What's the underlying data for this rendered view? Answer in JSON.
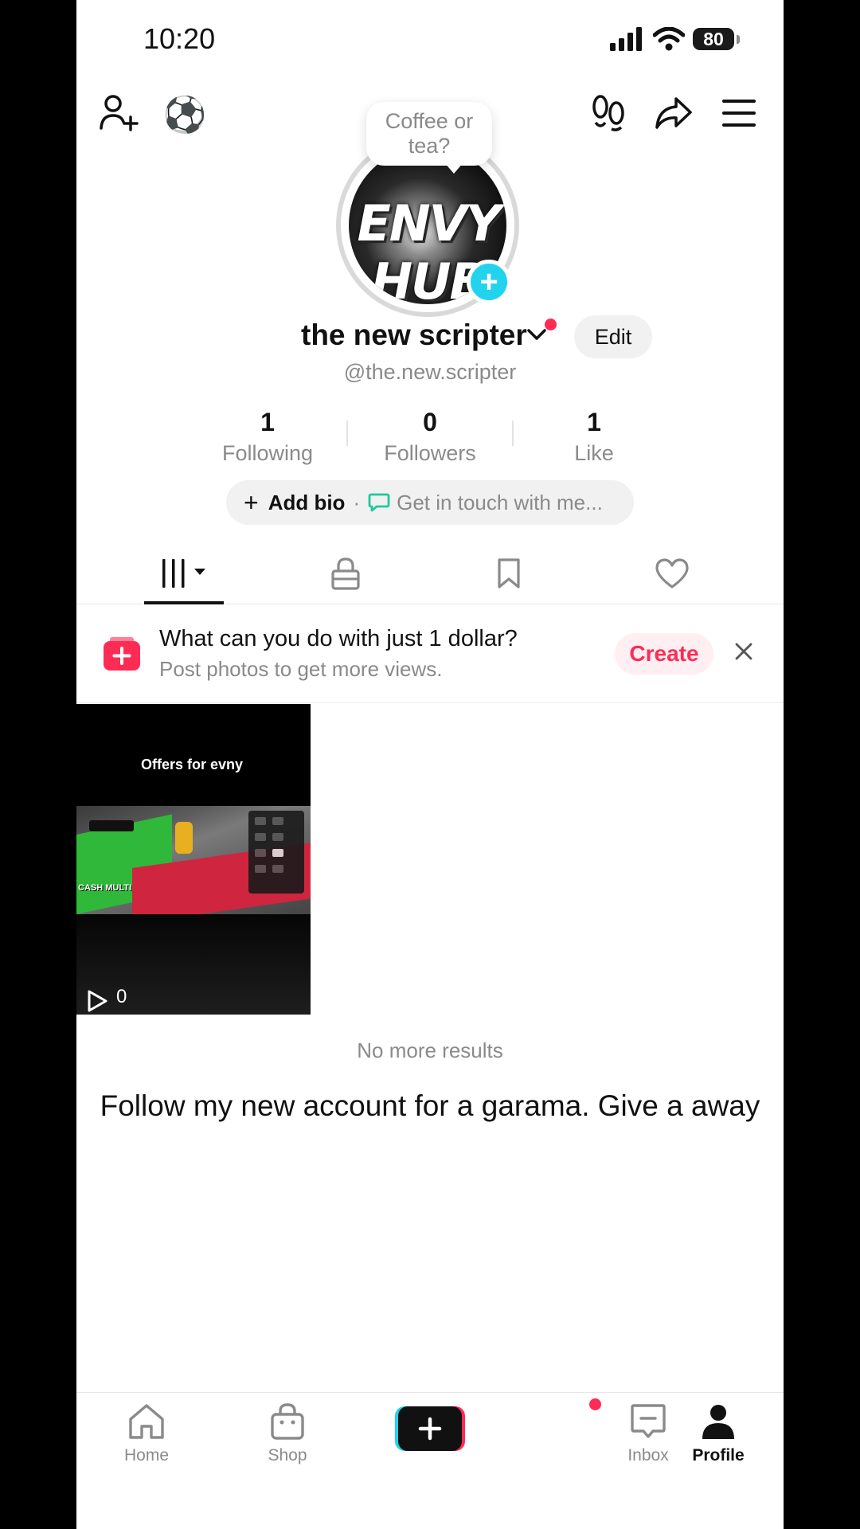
{
  "status_bar": {
    "time": "10:20",
    "battery": "80"
  },
  "header": {
    "emoji": "⚽"
  },
  "profile": {
    "bubble_text": "Coffee or tea?",
    "avatar_text": "ENVY HUB",
    "display_name": "the new scripter",
    "edit_label": "Edit",
    "handle": "@the.new.scripter"
  },
  "stats": [
    {
      "value": "1",
      "label": "Following"
    },
    {
      "value": "0",
      "label": "Followers"
    },
    {
      "value": "1",
      "label": "Like"
    }
  ],
  "bio": {
    "add_label": "Add bio",
    "separator": "·",
    "touch_label": "Get in touch with me..."
  },
  "promo": {
    "title": "What can you do with just 1 dollar?",
    "subtitle": "Post photos to get more views.",
    "create_label": "Create"
  },
  "video": {
    "title": "Offers for evny",
    "cash_text": "CASH MULTI",
    "views": "0"
  },
  "no_more_results": "No more results",
  "caption": "Follow my new account for a garama. Give a away",
  "nav": {
    "home": "Home",
    "shop": "Shop",
    "inbox": "Inbox",
    "profile": "Profile"
  },
  "colors": {
    "accent": "#fe2c55",
    "cyan": "#22d3ee"
  }
}
